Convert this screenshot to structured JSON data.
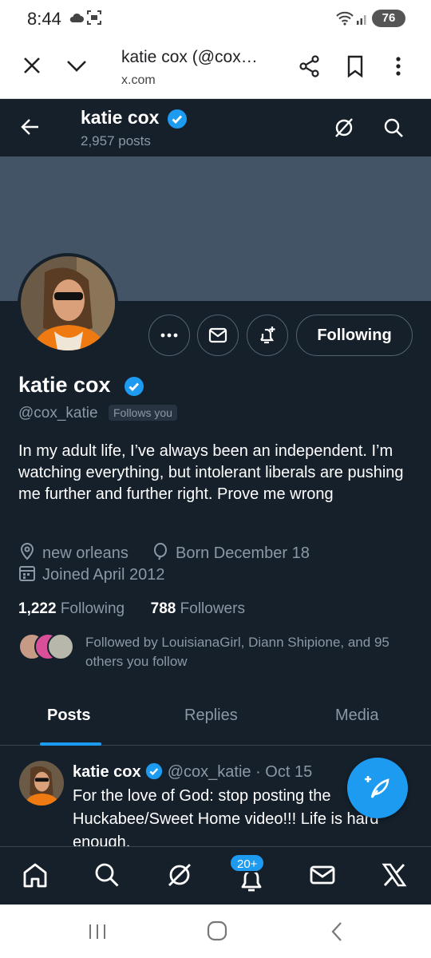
{
  "status_bar": {
    "time": "8:44",
    "battery": "76"
  },
  "browser": {
    "title": "katie cox (@cox…",
    "url": "x.com",
    "icons": [
      "close-icon",
      "chevron-down-icon",
      "share-icon",
      "bookmark-icon",
      "more-vert-icon"
    ]
  },
  "header": {
    "name": "katie cox",
    "posts": "2,957 posts"
  },
  "profile": {
    "name": "katie cox",
    "handle": "@cox_katie",
    "follows_you": "Follows you",
    "following_button": "Following",
    "bio": "In my adult life, I’ve always been an independent. I’m watching everything, but intolerant liberals are pushing me further and further right.  Prove me wrong",
    "location": "new orleans",
    "birthday": "Born December 18",
    "joined": "Joined April 2012",
    "following_count": "1,222",
    "following_label": "Following",
    "followers_count": "788",
    "followers_label": "Followers",
    "followed_by": "Followed by LouisianaGirl, Diann Shipione, and 95 others you follow"
  },
  "tabs": {
    "posts": "Posts",
    "replies": "Replies",
    "media": "Media"
  },
  "tweet": {
    "name": "katie cox",
    "handle_date": "@cox_katie · Oct 15",
    "text": "For the love of God: stop posting the Huckabee/Sweet Home video!!!  Life is hard enough."
  },
  "bottom_nav": {
    "notifications_badge": "20+"
  },
  "colors": {
    "background": "#15202b",
    "banner": "#425466",
    "accent": "#1d9bf0",
    "muted": "#8b98a5"
  }
}
